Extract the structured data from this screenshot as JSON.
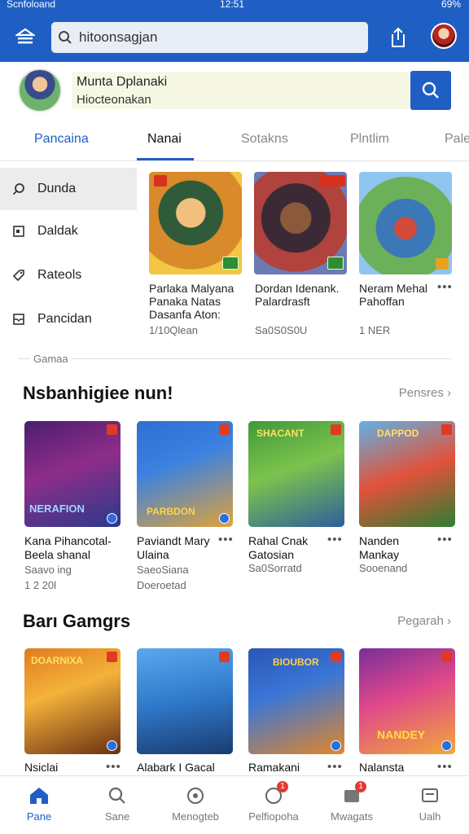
{
  "status_bar": {
    "carrier": "Scnfoloand",
    "time": "12:51",
    "battery": "69%"
  },
  "search": {
    "value": "hitoonsagjan"
  },
  "profile": {
    "name": "Munta Dplanaki",
    "subtitle": "Hiocteonakan"
  },
  "tabs": [
    "Pancaina",
    "Nanai",
    "Sotakns",
    "Plntlim",
    "Pale"
  ],
  "filters": [
    {
      "label": "Dunda",
      "icon": "search-icon"
    },
    {
      "label": "Daldak",
      "icon": "calendar-icon"
    },
    {
      "label": "Rateols",
      "icon": "tag-icon"
    },
    {
      "label": "Pancidan",
      "icon": "inbox-icon"
    }
  ],
  "featured": [
    {
      "title": "Parlaka Malyana\nPanaka Natas\nDasanfa Aton:",
      "meta": "1/10Qlean"
    },
    {
      "title": "Dordan Idenank.\nPalardrasft",
      "meta": "Sa0S0S0U"
    },
    {
      "title": "Neram Mehal\nPahoffan",
      "meta": "1 NER"
    }
  ],
  "divider_label": "Gamaa",
  "section1": {
    "title": "Nsbanhigiee nun!",
    "link": "Pensres",
    "games": [
      {
        "name": "Kana Pihancotal-\nBeela shanal",
        "meta": "Saavo ing\n1 2 20l"
      },
      {
        "name": "Paviandt Mary\nUlaina",
        "meta": "SaeoSiana\nDoeroetad"
      },
      {
        "name": "Rahal Cnak\nGatosian",
        "meta": "Sa0Sorratd"
      },
      {
        "name": "Nanden\nMankay",
        "meta": "Sooenand"
      }
    ],
    "art_titles": [
      "NERAFION",
      "PARBDON",
      "SHACANT",
      "DAPPOD"
    ]
  },
  "section2": {
    "title": "Barı Gamgrs",
    "link": "Pegarah",
    "games": [
      {
        "name": "Nsiclai"
      },
      {
        "name": "Alabark I Gacal"
      },
      {
        "name": "Ramakani"
      },
      {
        "name": "Nalansta"
      }
    ],
    "art_titles": [
      "DOARNIXA",
      "",
      "BIOUBOR",
      "NANDEY"
    ]
  },
  "bottom_nav": [
    {
      "label": "Pane",
      "icon": "home-icon",
      "active": true
    },
    {
      "label": "Sane",
      "icon": "search-icon"
    },
    {
      "label": "Menogteb",
      "icon": "discover-icon"
    },
    {
      "label": "Pelfiopoha",
      "icon": "chat-icon",
      "badge": "1"
    },
    {
      "label": "Mwagats",
      "icon": "folder-icon",
      "badge": "1"
    },
    {
      "label": "Ualh",
      "icon": "profile-icon"
    }
  ],
  "colors": {
    "brand": "#1f5fc4",
    "badge": "#d9301e"
  }
}
